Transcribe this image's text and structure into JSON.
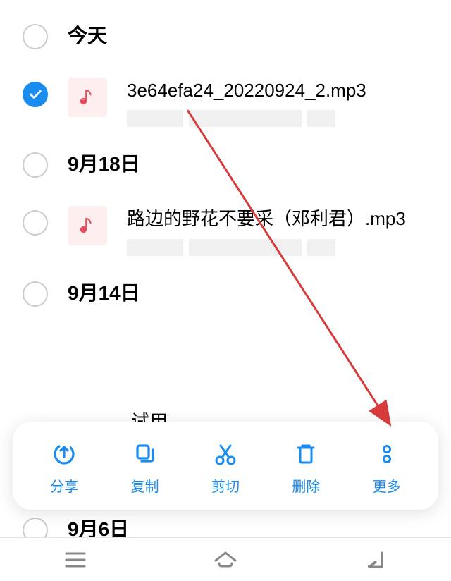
{
  "sections": {
    "today": "今天",
    "sep18": "9月18日",
    "sep14": "9月14日",
    "sep6": "9月6日"
  },
  "files": {
    "file1": {
      "name": "3e64efa24_20220924_2.mp3",
      "checked": true
    },
    "file2": {
      "name": "路边的野花不要采（邓利君）.mp3",
      "checked": false
    },
    "partial": "试用"
  },
  "actions": {
    "share": "分享",
    "copy": "复制",
    "cut": "剪切",
    "delete": "删除",
    "more": "更多"
  },
  "colors": {
    "accent": "#1a8cf0",
    "music_bg": "#fdeeef",
    "music_note": "#e94b5a",
    "arrow": "#d63a3a"
  }
}
